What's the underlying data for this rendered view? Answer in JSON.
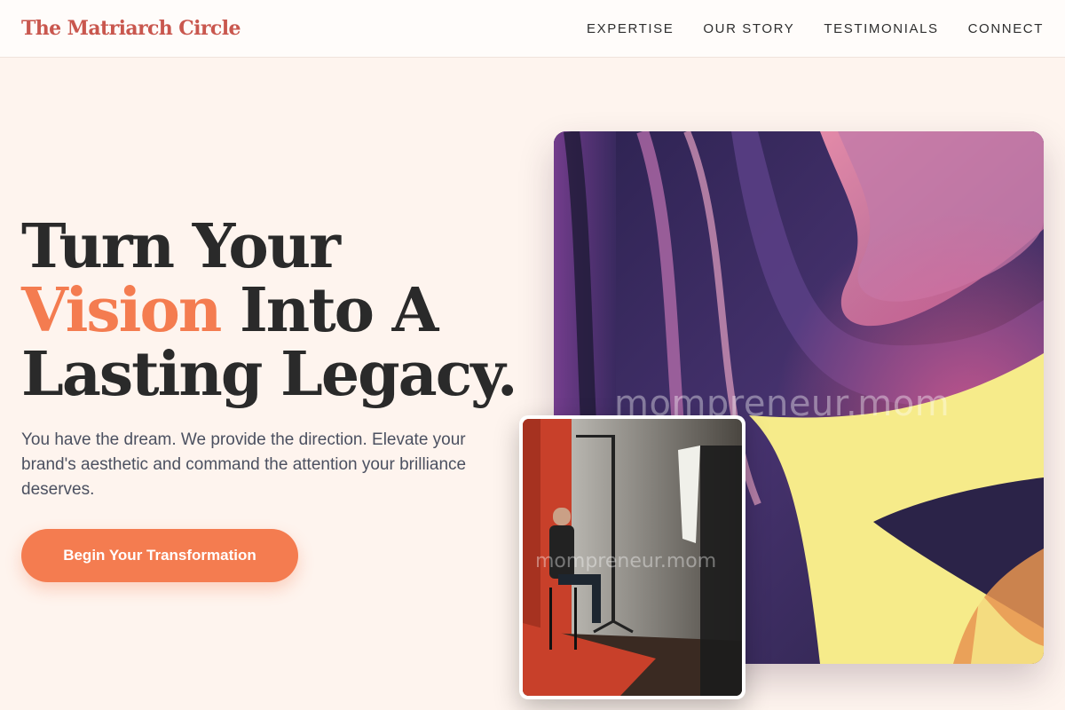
{
  "header": {
    "logo": "The Matriarch Circle",
    "nav": [
      "EXPERTISE",
      "OUR STORY",
      "TESTIMONIALS",
      "CONNECT"
    ]
  },
  "hero": {
    "title_line1": "Turn Your",
    "title_accent": "Vision",
    "title_line2_rest": " Into A",
    "title_line3": "Lasting Legacy.",
    "subtitle": "You have the dream. We provide the direction. Elevate your brand's aesthetic and command the attention your brilliance deserves.",
    "cta_label": "Begin Your Transformation"
  },
  "images": {
    "watermark": "mompreneur.mom"
  },
  "colors": {
    "accent": "#f47c50",
    "logo": "#c9574e",
    "background": "#fef4ee",
    "text_dark": "#2a2a2a"
  }
}
